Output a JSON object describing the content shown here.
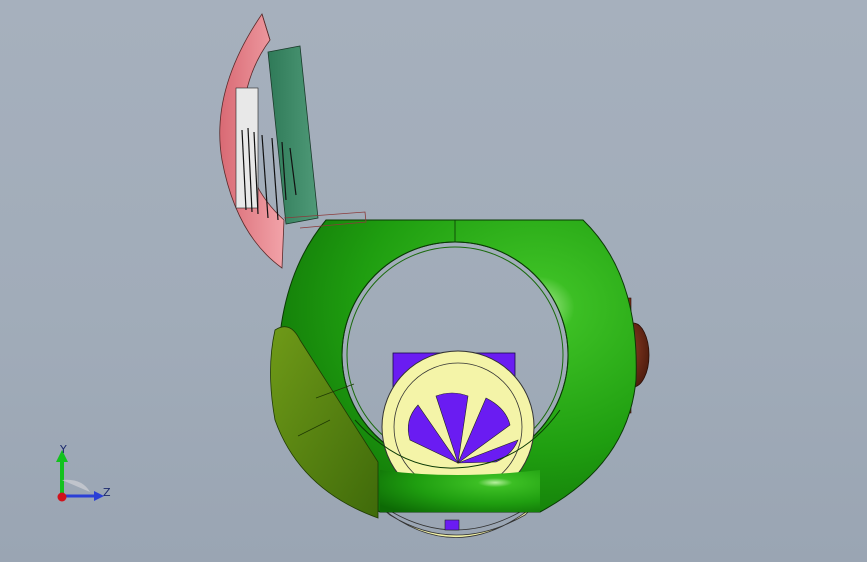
{
  "viewport": {
    "background_color": "#a2adba"
  },
  "model": {
    "colors": {
      "shell_green": "#1f9e10",
      "shell_dark_green": "#0f6a06",
      "flap_olive": "#5e8a12",
      "lid_pink": "#e27d86",
      "panel_teal": "#3e8a68",
      "block_purple": "#6a1cf2",
      "wheel_yellow": "#f4f4a8",
      "knob_brown": "#6a2a18"
    }
  },
  "triad": {
    "y_label": "Y",
    "z_label": "Z",
    "y_color": "#13c21d",
    "z_color": "#2a3fd6",
    "x_color": "#d0121c"
  }
}
